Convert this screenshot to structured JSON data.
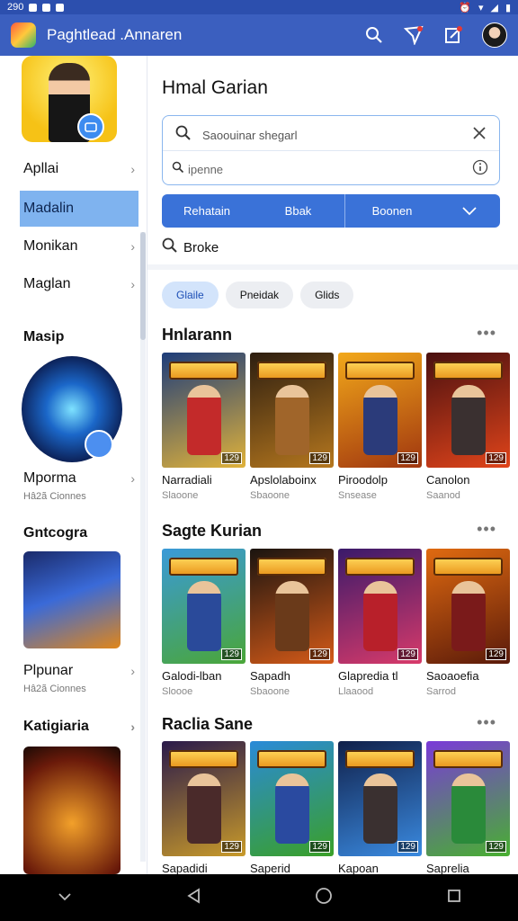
{
  "status": {
    "time": "290"
  },
  "appbar": {
    "title": "Paghtlead .Annaren"
  },
  "sidebar": {
    "items": [
      {
        "label": "Apllai",
        "active": false,
        "chevron": true
      },
      {
        "label": "Madalin",
        "active": true,
        "chevron": false
      },
      {
        "label": "Monikan",
        "active": false,
        "chevron": true
      },
      {
        "label": "Maglan",
        "active": false,
        "chevron": true
      }
    ],
    "section1_title": "Masip",
    "feature1": {
      "label": "Mporma",
      "sub": "Hâ2ã Cionnes"
    },
    "section2_title": "Gntcogra",
    "feature2": {
      "label": "Plpunar",
      "sub": "Hâ2ã Cionnes"
    },
    "section3_title": "Katigiaria"
  },
  "main": {
    "title": "Hmal Garian",
    "search": {
      "placeholder": "Saoouinar shegarl",
      "filter_text": "ipenne"
    },
    "segments": [
      "Rehatain",
      "Bbak",
      "Boonen"
    ],
    "browse_label": "Broke",
    "chips": [
      {
        "label": "Glaile",
        "selected": true
      },
      {
        "label": "Pneidak",
        "selected": false
      },
      {
        "label": "Glids",
        "selected": false
      }
    ],
    "sections": [
      {
        "title": "Hnlarann",
        "cards": [
          {
            "title": "Narradiali",
            "sub": "Slaoone",
            "tag": "129",
            "bg": [
              "#1d3c7a",
              "#e0b23a"
            ],
            "hero": "#c32a2a"
          },
          {
            "title": "Apslolaboinx",
            "sub": "Sbaoone",
            "tag": "129",
            "bg": [
              "#2d1e10",
              "#b5771e"
            ],
            "hero": "#a0652a"
          },
          {
            "title": "Piroodolp",
            "sub": "Snsease",
            "tag": "129",
            "bg": [
              "#f2a81a",
              "#a0360f"
            ],
            "hero": "#2b3b7a"
          },
          {
            "title": "Canolon",
            "sub": "Saanod",
            "tag": "129",
            "bg": [
              "#4a1010",
              "#e0441a"
            ],
            "hero": "#3a3030"
          }
        ]
      },
      {
        "title": "Sagte Kurian",
        "cards": [
          {
            "title": "Galodi-lban",
            "sub": "Sloooe",
            "tag": "129",
            "bg": [
              "#3a9ad8",
              "#4aa638"
            ],
            "hero": "#2a4a9a"
          },
          {
            "title": "Sapadh",
            "sub": "Sbaoone",
            "tag": "129",
            "bg": [
              "#1a1410",
              "#d45a18"
            ],
            "hero": "#6a3a1a"
          },
          {
            "title": "Glapredia tl",
            "sub": "Llaaood",
            "tag": "129",
            "bg": [
              "#3a1a6a",
              "#d83a6a"
            ],
            "hero": "#b8202a"
          },
          {
            "title": "Saoaoefia",
            "sub": "Sarrod",
            "tag": "129",
            "bg": [
              "#e06a10",
              "#5a1a0a"
            ],
            "hero": "#7a1a1a"
          }
        ]
      },
      {
        "title": "Raclia Sane",
        "cards": [
          {
            "title": "Sapadidi",
            "sub": "",
            "tag": "129",
            "bg": [
              "#2a1a4a",
              "#c89a2a"
            ],
            "hero": "#4a2a2a"
          },
          {
            "title": "Saperid",
            "sub": "",
            "tag": "129",
            "bg": [
              "#2a8ad8",
              "#3aa028"
            ],
            "hero": "#2a4aa0"
          },
          {
            "title": "Kapoan",
            "sub": "",
            "tag": "129",
            "bg": [
              "#10204a",
              "#3a8ae0"
            ],
            "hero": "#3a3030"
          },
          {
            "title": "Saprelia",
            "sub": "",
            "tag": "129",
            "bg": [
              "#7a3ad8",
              "#48b030"
            ],
            "hero": "#2a8a3a"
          }
        ]
      }
    ]
  },
  "colors": {
    "appbar": "#3b5fbf",
    "accent": "#3a72d8",
    "active_item": "#7fb3ef"
  }
}
